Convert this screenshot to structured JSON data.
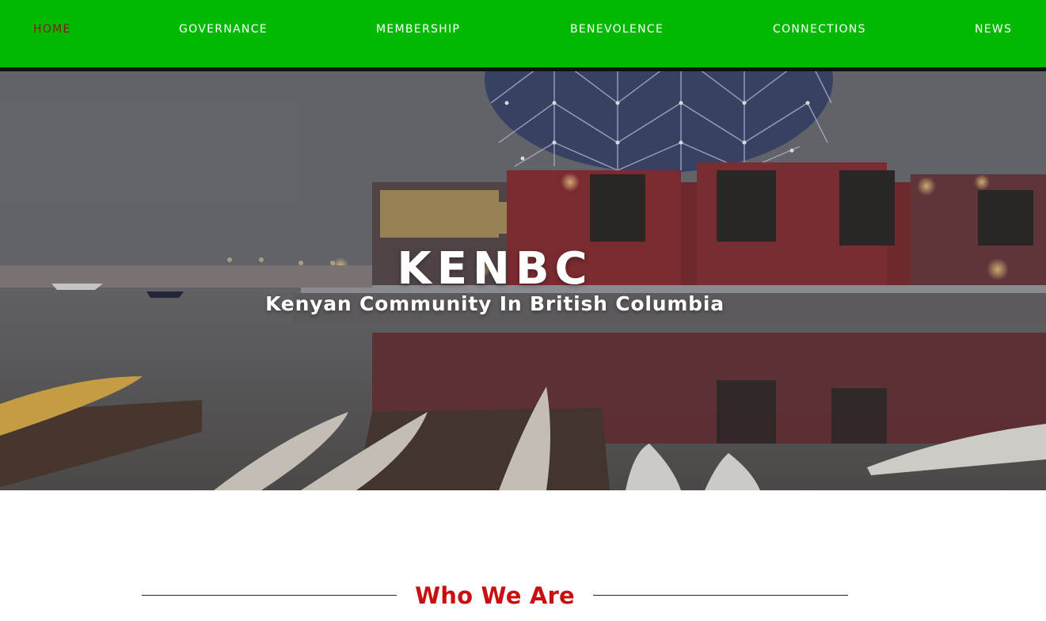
{
  "nav": {
    "items": [
      {
        "label": "HOME",
        "active": true
      },
      {
        "label": "GOVERNANCE",
        "active": false
      },
      {
        "label": "MEMBERSHIP",
        "active": false
      },
      {
        "label": "BENEVOLENCE",
        "active": false
      },
      {
        "label": "CONNECTIONS",
        "active": false
      },
      {
        "label": "NEWS",
        "active": false
      }
    ],
    "background_color": "#00b900",
    "active_color": "#8a1a1a"
  },
  "hero": {
    "title": "KENBC",
    "subtitle": "Kenyan Community In British Columbia"
  },
  "section": {
    "title": "Who We Are",
    "title_color": "#c81010"
  }
}
